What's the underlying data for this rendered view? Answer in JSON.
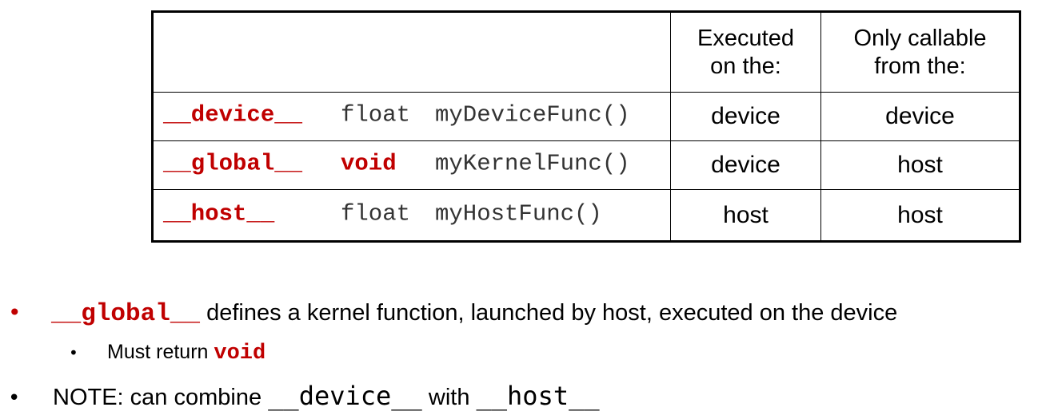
{
  "table": {
    "header": {
      "executed_on": "Executed\non the:",
      "callable_from": "Only callable\nfrom the:"
    },
    "rows": [
      {
        "qualifier": "__device__",
        "return_type": "float",
        "func": "myDeviceFunc()",
        "executed_on": "device",
        "callable_from": "device"
      },
      {
        "qualifier": "__global__",
        "return_type": "void",
        "func": "myKernelFunc()",
        "executed_on": "device",
        "callable_from": "host"
      },
      {
        "qualifier": "__host__",
        "return_type": "float",
        "func": "myHostFunc()",
        "executed_on": "host",
        "callable_from": "host"
      }
    ]
  },
  "bullets": {
    "first": {
      "marker": "•",
      "code": "__global__",
      "text": " defines a kernel function, launched by host, executed on the device"
    },
    "second": {
      "marker": "•",
      "text": "Must return ",
      "code": "void"
    },
    "third": {
      "marker": "•",
      "text_before": "NOTE: can combine ",
      "code_a": "__device__",
      "text_middle": " with ",
      "code_b": "__host__"
    }
  }
}
